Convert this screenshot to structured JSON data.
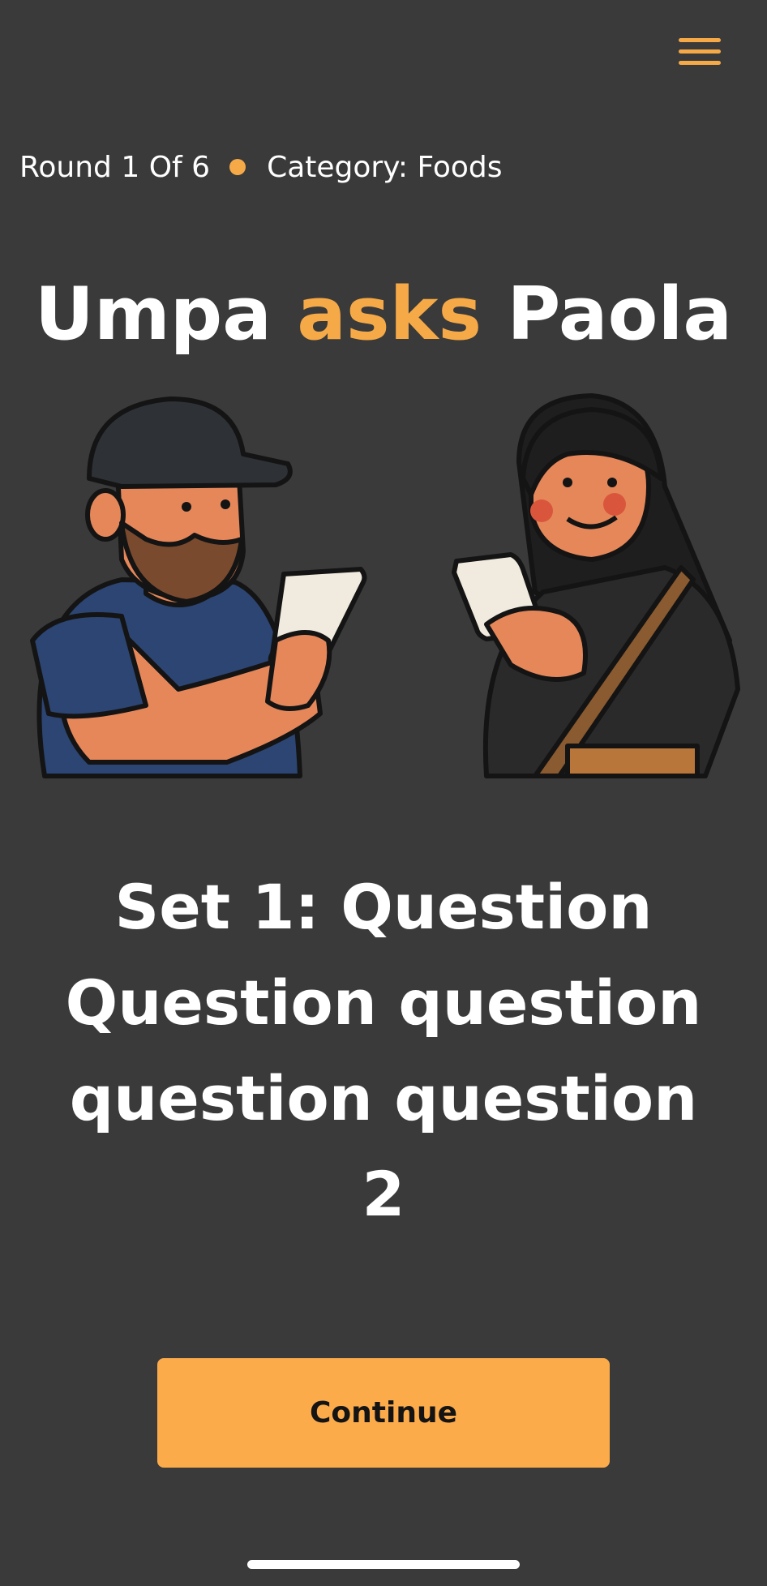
{
  "header": {
    "menu_icon": "hamburger-menu-icon"
  },
  "round_info": {
    "round_text": "Round 1 Of 6",
    "category_text": "Category: Foods"
  },
  "title": {
    "asker": "Umpa",
    "verb": "asks",
    "answerer": "Paola"
  },
  "question": {
    "text": "Set 1: Question Question question question question 2"
  },
  "actions": {
    "continue_label": "Continue"
  },
  "colors": {
    "background": "#3a3a3a",
    "accent": "#f6a947",
    "button": "#fcab4b",
    "text": "#ffffff"
  }
}
